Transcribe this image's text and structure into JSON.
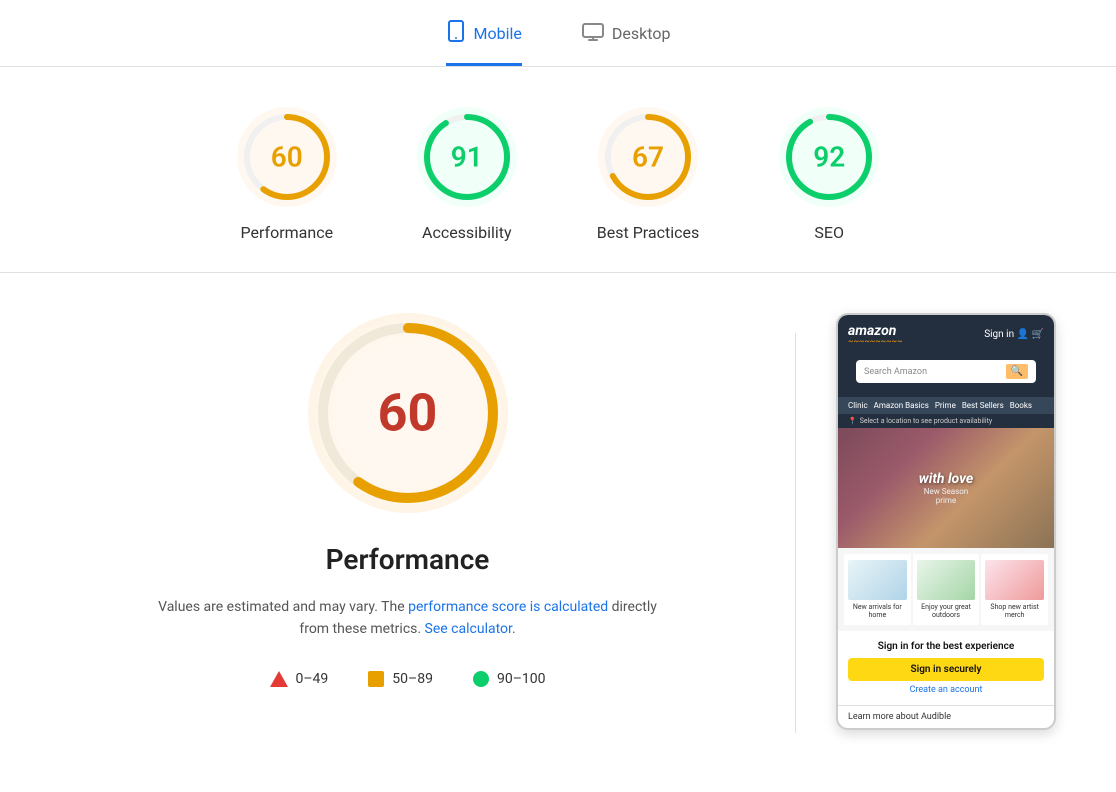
{
  "tabs": {
    "mobile": {
      "label": "Mobile",
      "active": true
    },
    "desktop": {
      "label": "Desktop",
      "active": false
    }
  },
  "scores": [
    {
      "id": "performance",
      "label": "Performance",
      "value": 60,
      "color": "#e8a000",
      "trackColor": "#fef3e2",
      "bgType": "orange",
      "percent": 60
    },
    {
      "id": "accessibility",
      "label": "Accessibility",
      "value": 91,
      "color": "#0cce6b",
      "trackColor": "#e6faf0",
      "bgType": "green",
      "percent": 91
    },
    {
      "id": "best-practices",
      "label": "Best Practices",
      "value": 67,
      "color": "#e8a000",
      "trackColor": "#fef3e2",
      "bgType": "orange",
      "percent": 67
    },
    {
      "id": "seo",
      "label": "SEO",
      "value": 92,
      "color": "#0cce6b",
      "trackColor": "#e6faf0",
      "bgType": "green",
      "percent": 92
    }
  ],
  "main": {
    "score": 60,
    "title": "Performance",
    "description_start": "Values are estimated and may vary. The ",
    "link1_text": "performance score is calculated",
    "link1_url": "#",
    "description_mid": " directly from these metrics. ",
    "link2_text": "See calculator",
    "link2_url": "#",
    "description_end": "."
  },
  "legend": [
    {
      "id": "red",
      "range": "0–49",
      "type": "triangle",
      "color": "#e53935"
    },
    {
      "id": "orange",
      "range": "50–89",
      "type": "square",
      "color": "#e8a000"
    },
    {
      "id": "green",
      "range": "90–100",
      "type": "circle",
      "color": "#0cce6b"
    }
  ],
  "phone": {
    "logo": "amazon",
    "signin_header": "Sign in",
    "search_placeholder": "Search Amazon",
    "nav_items": [
      "Clinic",
      "Amazon Basics",
      "Prime",
      "Best Sellers",
      "Books"
    ],
    "location_text": "Select a location to see product availability",
    "hero_text": "with love",
    "hero_sub": "New Season prime",
    "cards": [
      {
        "label": "New arrivals for home"
      },
      {
        "label": "Enjoy your great outdoors"
      },
      {
        "label": "Shop new artist merch"
      }
    ],
    "signin_section": "Sign in for the best experience",
    "signin_btn": "Sign in securely",
    "create_account": "Create an account",
    "footer": "Learn more about Audible"
  }
}
